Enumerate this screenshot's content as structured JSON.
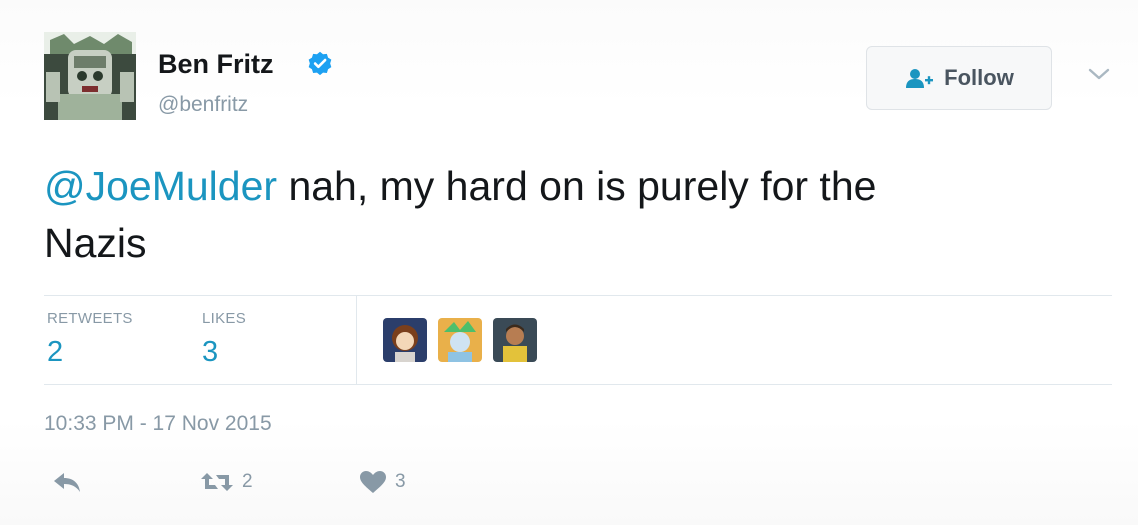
{
  "user": {
    "name": "Ben Fritz",
    "handle": "@benfritz",
    "verified": true
  },
  "header": {
    "follow_label": "Follow"
  },
  "tweet": {
    "mention": "@JoeMulder",
    "text_line1": " nah, my hard on is purely for the",
    "text_line2": "Nazis"
  },
  "stats": {
    "retweets_label": "RETWEETS",
    "retweets_value": "2",
    "likes_label": "LIKES",
    "likes_value": "3"
  },
  "timestamp": "10:33 PM - 17 Nov 2015",
  "actions": {
    "retweet_count": "2",
    "like_count": "3"
  },
  "icons": {
    "verified": "verified-badge-icon",
    "follow": "add-user-icon",
    "chevron": "chevron-down-icon",
    "reply": "reply-icon",
    "retweet": "retweet-icon",
    "like": "heart-icon"
  },
  "colors": {
    "accent": "#1b95c0",
    "muted": "#8899a6",
    "text": "#14171a",
    "verified": "#1da1f2"
  }
}
